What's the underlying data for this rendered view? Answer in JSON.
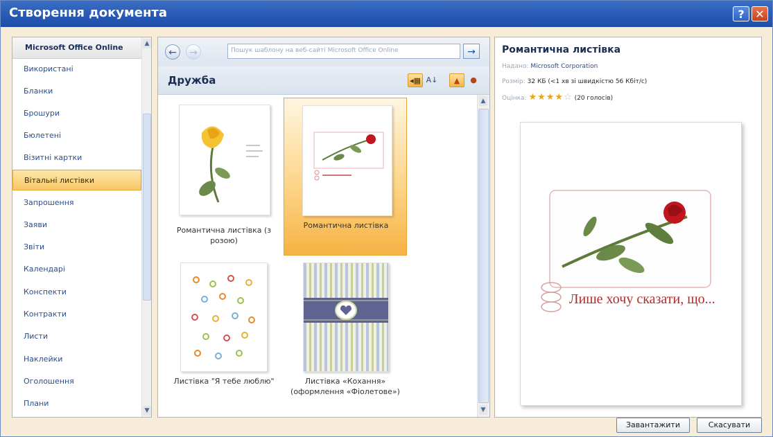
{
  "window": {
    "title": "Створення документа",
    "help_icon": "?",
    "close_icon": "✕"
  },
  "categories": {
    "header": "Microsoft Office Online",
    "items": [
      "Використані",
      "Бланки",
      "Брошури",
      "Бюлетені",
      "Візитні картки",
      "Вітальні листівки",
      "Запрошення",
      "Заяви",
      "Звіти",
      "Календарі",
      "Конспекти",
      "Контракти",
      "Листи",
      "Наклейки",
      "Оголошення",
      "Плани"
    ],
    "selected": "Вітальні листівки"
  },
  "toolbar": {
    "back_icon": "←",
    "forward_icon": "→",
    "search_placeholder": "Пошук шаблону на веб-сайті Microsoft Office Online",
    "go_icon": "→"
  },
  "gallery": {
    "category_title": "Дружба",
    "templates": [
      {
        "label": "Романтична листівка (з розою)"
      },
      {
        "label": "Романтична листівка"
      },
      {
        "label": "Листівка \"Я тебе люблю\""
      },
      {
        "label": "Листівка «Кохання» (оформлення «Фіолетове»)"
      }
    ],
    "selected_index": 1
  },
  "details": {
    "title": "Романтична листівка",
    "publisher_label": "Надано:",
    "publisher": "Microsoft Corporation",
    "size_label": "Розмір:",
    "size": "32 КБ (<1 хв зі швидкістю 56 Кбіт/с)",
    "rating_label": "Оцінка:",
    "rating": 4,
    "rating_max": 5,
    "votes": "(20 голосів)",
    "preview_caption": "Лише хочу сказати, що..."
  },
  "buttons": {
    "download": "Завантажити",
    "cancel": "Скасувати"
  }
}
